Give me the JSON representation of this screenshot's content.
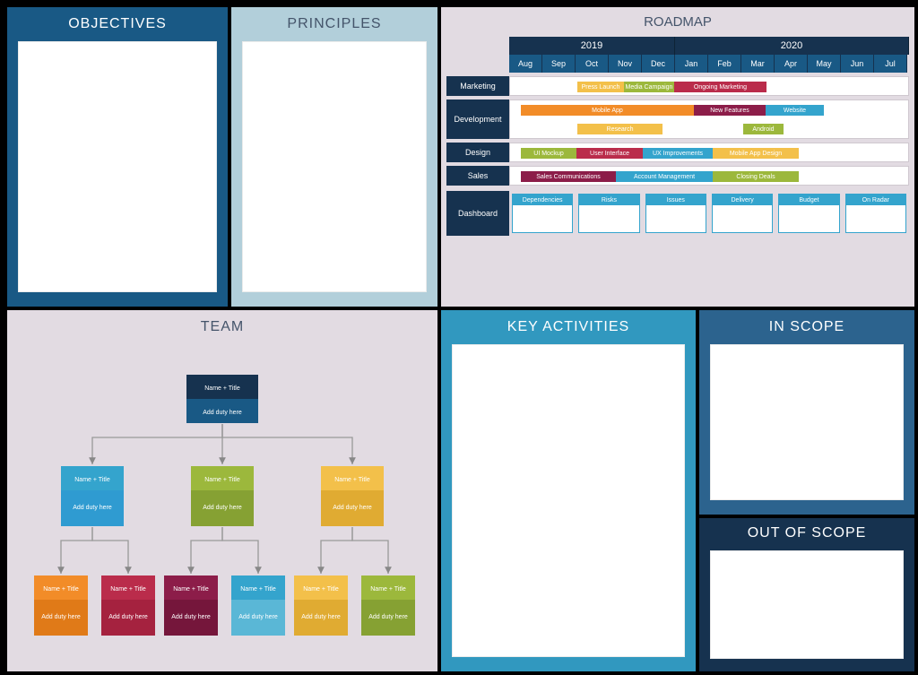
{
  "panels": {
    "objectives": "OBJECTIVES",
    "principles": "PRINCIPLES",
    "roadmap": "ROADMAP",
    "team": "TEAM",
    "key_activities": "KEY ACTIVITIES",
    "in_scope": "IN SCOPE",
    "out_of_scope": "OUT OF SCOPE"
  },
  "roadmap": {
    "years": [
      "2019",
      "2020"
    ],
    "months": [
      "Aug",
      "Sep",
      "Oct",
      "Nov",
      "Dec",
      "Jan",
      "Feb",
      "Mar",
      "Apr",
      "May",
      "Jun",
      "Jul"
    ],
    "rows": {
      "marketing": "Marketing",
      "development": "Development",
      "design": "Design",
      "sales": "Sales",
      "dashboard": "Dashboard"
    },
    "bars": {
      "press_launch": "Press Launch",
      "media_campaign": "Media Campaign",
      "ongoing_marketing": "Ongoing Marketing",
      "mobile_app": "Mobile App",
      "research": "Research",
      "new_features": "New Features",
      "website": "Website",
      "android": "Android",
      "ui_mockup": "UI Mockup",
      "user_interface": "User Interface",
      "ux_improvements": "UX Improvements",
      "mobile_app_design": "Mobile App Design",
      "sales_comm": "Sales Communications",
      "account_mgmt": "Account Management",
      "closing_deals": "Closing Deals"
    },
    "dashboard_items": [
      "Dependencies",
      "Risks",
      "Issues",
      "Delivery",
      "Budget",
      "On Radar"
    ]
  },
  "team": {
    "name_title": "Name + Title",
    "add_duty": "Add duty here"
  },
  "chart_data": {
    "type": "gantt",
    "title": "ROADMAP",
    "categories": [
      "Aug",
      "Sep",
      "Oct",
      "Nov",
      "Dec",
      "Jan",
      "Feb",
      "Mar",
      "Apr",
      "May",
      "Jun",
      "Jul"
    ],
    "year_spans": [
      {
        "label": "2019",
        "months": [
          "Aug",
          "Sep",
          "Oct",
          "Nov",
          "Dec"
        ],
        "offset_months": 0,
        "span_months": 5
      },
      {
        "label": "2020",
        "months": [
          "Jan",
          "Feb",
          "Mar",
          "Apr",
          "May",
          "Jun",
          "Jul"
        ],
        "offset_months": 5,
        "span_months": 7
      }
    ],
    "xlabel": "",
    "ylabel": "",
    "series": [
      {
        "lane": "Marketing",
        "name": "Press Launch",
        "start": "Oct",
        "end": "Oct",
        "offset_months": 2.0,
        "duration_months": 1.4,
        "color": "#f3c04a"
      },
      {
        "lane": "Marketing",
        "name": "Media Campaign",
        "start": "Nov",
        "end": "Dec",
        "offset_months": 3.4,
        "duration_months": 1.5,
        "color": "#9cb83c"
      },
      {
        "lane": "Marketing",
        "name": "Ongoing Marketing",
        "start": "Jan",
        "end": "Mar",
        "offset_months": 4.9,
        "duration_months": 2.8,
        "color": "#ba2c4b"
      },
      {
        "lane": "Development",
        "row": 0,
        "name": "Mobile App",
        "start": "Aug",
        "end": "Jan",
        "offset_months": 0.3,
        "duration_months": 5.2,
        "color": "#f28c28"
      },
      {
        "lane": "Development",
        "row": 0,
        "name": "New Features",
        "start": "Jan",
        "end": "Mar",
        "offset_months": 5.5,
        "duration_months": 2.2,
        "color": "#8c1d49"
      },
      {
        "lane": "Development",
        "row": 0,
        "name": "Website",
        "start": "Mar",
        "end": "May",
        "offset_months": 7.7,
        "duration_months": 1.8,
        "color": "#34a4cd"
      },
      {
        "lane": "Development",
        "row": 1,
        "name": "Research",
        "start": "Oct",
        "end": "Dec",
        "offset_months": 2.0,
        "duration_months": 2.6,
        "color": "#f3c04a"
      },
      {
        "lane": "Development",
        "row": 1,
        "name": "Android",
        "start": "Mar",
        "end": "Mar",
        "offset_months": 7.0,
        "duration_months": 1.2,
        "color": "#9cb83c"
      },
      {
        "lane": "Design",
        "name": "UI Mockup",
        "start": "Aug",
        "end": "Sep",
        "offset_months": 0.3,
        "duration_months": 1.7,
        "color": "#9cb83c"
      },
      {
        "lane": "Design",
        "name": "User Interface",
        "start": "Oct",
        "end": "Nov",
        "offset_months": 2.0,
        "duration_months": 2.0,
        "color": "#ba2c4b"
      },
      {
        "lane": "Design",
        "name": "UX Improvements",
        "start": "Dec",
        "end": "Jan",
        "offset_months": 4.0,
        "duration_months": 2.1,
        "color": "#34a4cd"
      },
      {
        "lane": "Design",
        "name": "Mobile App Design",
        "start": "Feb",
        "end": "Apr",
        "offset_months": 6.1,
        "duration_months": 2.6,
        "color": "#f3c04a"
      },
      {
        "lane": "Sales",
        "name": "Sales Communications",
        "start": "Aug",
        "end": "Nov",
        "offset_months": 0.3,
        "duration_months": 2.9,
        "color": "#8c1d49"
      },
      {
        "lane": "Sales",
        "name": "Account Management",
        "start": "Nov",
        "end": "Feb",
        "offset_months": 3.2,
        "duration_months": 2.9,
        "color": "#34a4cd"
      },
      {
        "lane": "Sales",
        "name": "Closing Deals",
        "start": "Feb",
        "end": "Apr",
        "offset_months": 6.1,
        "duration_months": 2.6,
        "color": "#9cb83c"
      }
    ],
    "dashboard_items": [
      "Dependencies",
      "Risks",
      "Issues",
      "Delivery",
      "Budget",
      "On Radar"
    ]
  }
}
